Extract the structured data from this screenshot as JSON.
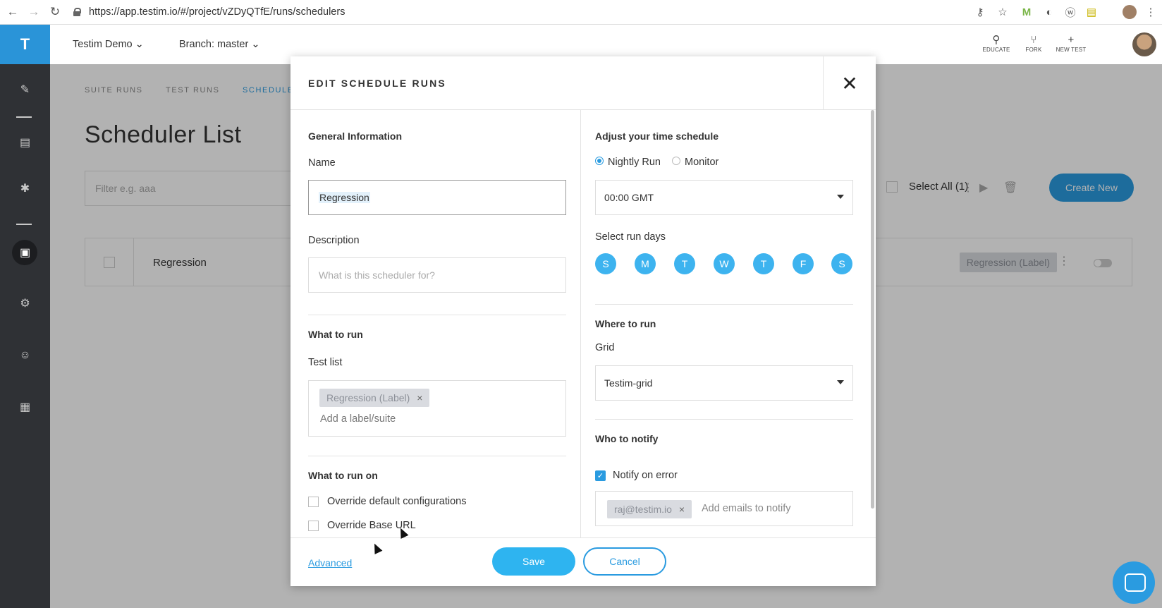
{
  "browser": {
    "url": "https://app.testim.io/#/project/vZDyQTfE/runs/schedulers",
    "back": "←",
    "forward": "→",
    "reload": "↻"
  },
  "header": {
    "project": "Testim Demo",
    "branch": "Branch: master",
    "tools": [
      {
        "label": "EDUCATE",
        "icon": "lightbulb-icon",
        "glyph": "⚲"
      },
      {
        "label": "FORK",
        "icon": "fork-icon",
        "glyph": "⑂"
      },
      {
        "label": "NEW TEST",
        "icon": "plus-icon",
        "glyph": "+"
      }
    ]
  },
  "rail": {
    "logo": "T"
  },
  "tabs": [
    "SUITE RUNS",
    "TEST RUNS",
    "SCHEDULE"
  ],
  "page": {
    "title": "Scheduler List",
    "filter_placeholder": "Filter e.g. aaa",
    "select_all": "Select All (1)",
    "create_new": "Create New",
    "row": {
      "name": "Regression",
      "label": "Regression (Label)"
    }
  },
  "modal": {
    "title": "EDIT SCHEDULE RUNS",
    "close": "✕",
    "general_info": "General Information",
    "name_label": "Name",
    "name_value": "Regression",
    "description_label": "Description",
    "description_placeholder": "What is this scheduler for?",
    "what_to_run": "What to run",
    "test_list_label": "Test list",
    "test_list_chip": "Regression (Label)",
    "chip_remove": "×",
    "test_list_placeholder": "Add a label/suite",
    "what_to_run_on": "What to run on",
    "override_config": "Override default configurations",
    "override_base_url": "Override Base URL",
    "adjust_schedule": "Adjust your time schedule",
    "nightly_run": "Nightly Run",
    "monitor": "Monitor",
    "time_value": "00:00 GMT",
    "select_run_days": "Select run days",
    "days": [
      "S",
      "M",
      "T",
      "W",
      "T",
      "F",
      "S"
    ],
    "where_to_run": "Where to run",
    "grid_label": "Grid",
    "grid_value": "Testim-grid",
    "who_to_notify": "Who to notify",
    "notify_on_error": "Notify on error",
    "email_chip": "raj@testim.io",
    "email_placeholder": "Add emails to notify",
    "advanced": "Advanced",
    "save": "Save",
    "cancel": "Cancel"
  },
  "colors": {
    "accent": "#2a9be0",
    "day": "#3db3ef",
    "rail": "#2f3135"
  }
}
